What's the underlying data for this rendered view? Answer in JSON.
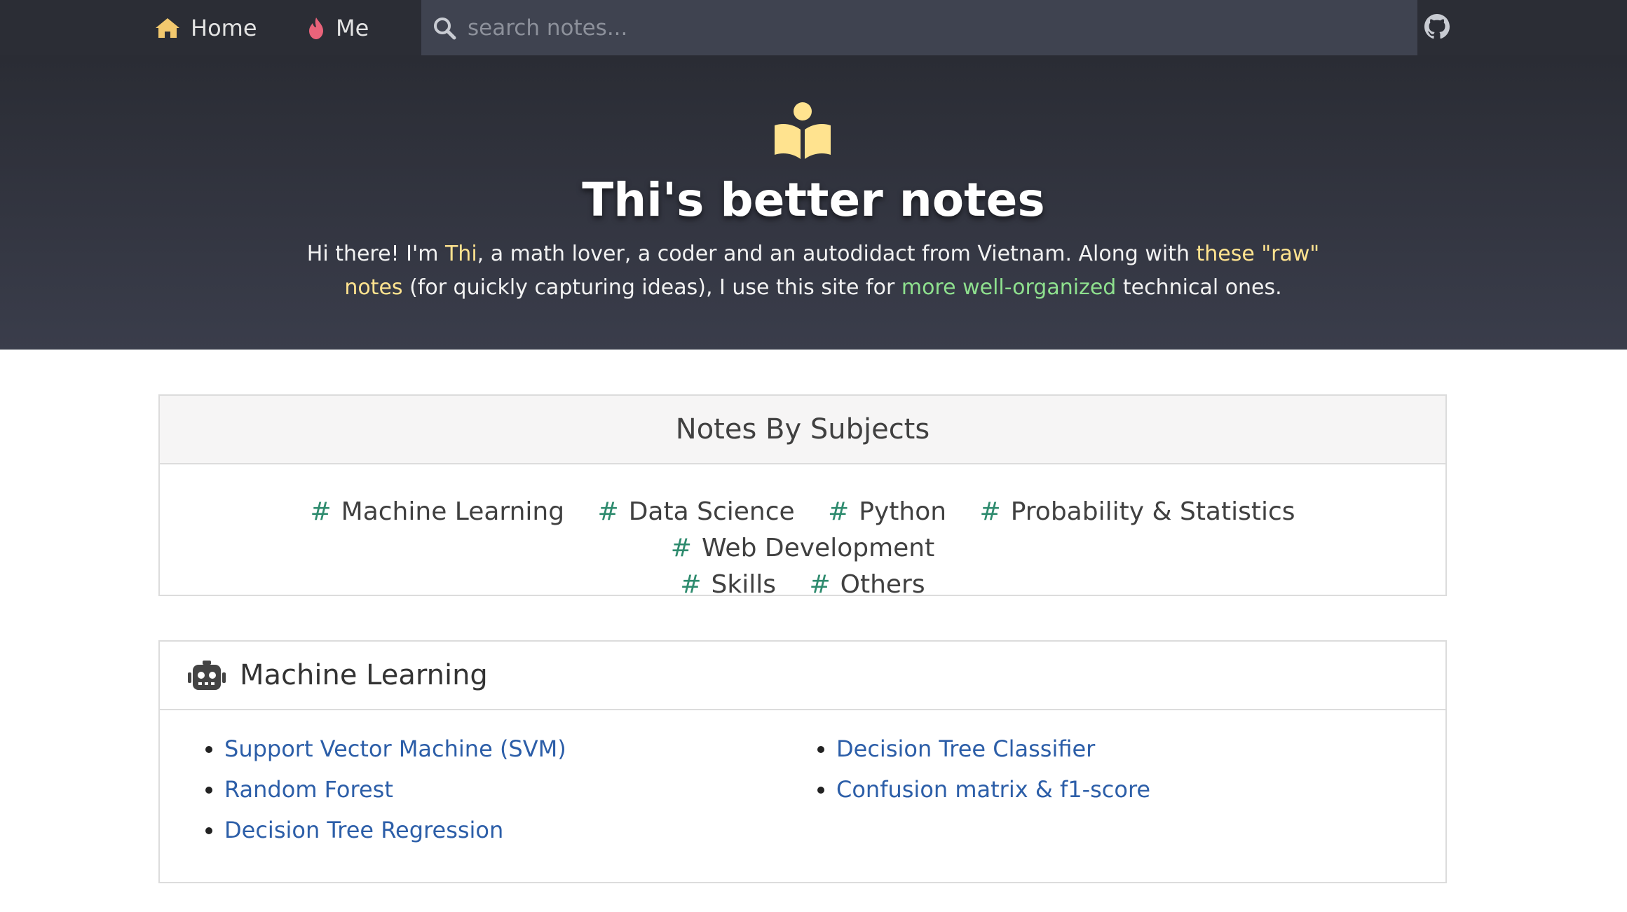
{
  "nav": {
    "home_label": "Home",
    "me_label": "Me",
    "search_placeholder": "search notes..."
  },
  "hero": {
    "title": "Thi's better notes",
    "intro_1": "Hi there! I'm ",
    "intro_name": "Thi",
    "intro_2": ", a math lover, a coder and an autodidact from Vietnam. Along with ",
    "intro_link_raw": "these \"raw\" notes",
    "intro_3": " (for quickly capturing ideas), I use this site for ",
    "intro_link_organized": "more well-organized",
    "intro_4": " technical ones."
  },
  "subjects": {
    "heading": "Notes By Subjects",
    "hash": "#",
    "tags": [
      "Machine Learning",
      "Data Science",
      "Python",
      "Probability & Statistics",
      "Web Development",
      "Skills",
      "Others"
    ]
  },
  "ml_section": {
    "heading": "Machine Learning",
    "left": [
      "Support Vector Machine (SVM)",
      "Random Forest",
      "Decision Tree Regression"
    ],
    "right": [
      "Decision Tree Classifier",
      "Confusion matrix & f1-score"
    ]
  },
  "colors": {
    "nav_bg": "#2b2d35",
    "accent_yellow": "#ffe38f",
    "accent_green": "#8ee08e",
    "link_blue": "#2c5ea8",
    "hash_green": "#2e8b6e"
  }
}
